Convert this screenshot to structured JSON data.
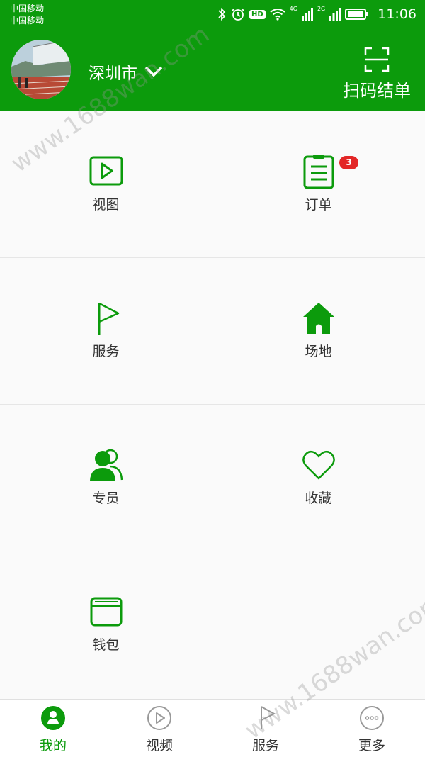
{
  "status": {
    "carrier_1": "中国移动",
    "carrier_2": "中国移动",
    "hd": "HD",
    "net_1": "4G",
    "net_2": "2G",
    "time": "11:06"
  },
  "header": {
    "city": "深圳市",
    "scan_label": "扫码结单"
  },
  "grid": {
    "view": "视图",
    "orders": "订单",
    "orders_badge": "3",
    "service": "服务",
    "venue": "场地",
    "staff": "专员",
    "favorite": "收藏",
    "wallet": "钱包"
  },
  "tabs": {
    "mine": "我的",
    "video": "视频",
    "service": "服务",
    "more": "更多"
  },
  "watermark": "www.1688wan.com",
  "colors": {
    "brand_green": "#0c9b0c",
    "badge_red": "#e32626",
    "grid_bg": "#fafafa"
  }
}
